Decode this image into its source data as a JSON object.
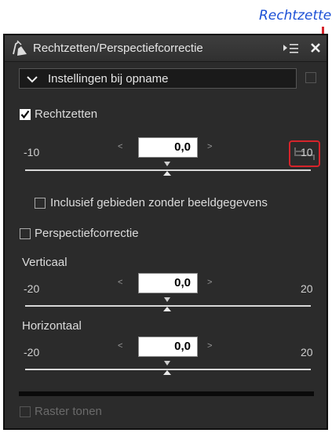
{
  "callout": {
    "label": "Rechtzetten"
  },
  "panel": {
    "title": "Rechtzetten/Perspectiefcorrectie",
    "preset": "Instellingen bij opname"
  },
  "straighten": {
    "label": "Rechtzetten",
    "checked": true,
    "min": "-10",
    "max": "10",
    "value": "0,0"
  },
  "include_empty": {
    "label": "Inclusief gebieden zonder beeldgegevens",
    "checked": false
  },
  "perspective": {
    "label": "Perspectiefcorrectie",
    "checked": false,
    "vertical": {
      "label": "Verticaal",
      "min": "-20",
      "max": "20",
      "value": "0,0"
    },
    "horizontal": {
      "label": "Horizontaal",
      "min": "-20",
      "max": "20",
      "value": "0,0"
    }
  },
  "grid": {
    "label": "Raster tonen",
    "checked": false
  }
}
